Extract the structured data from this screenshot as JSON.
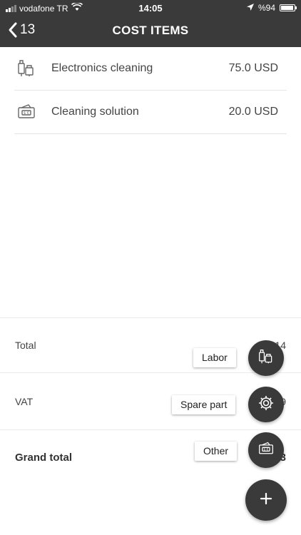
{
  "status_bar": {
    "carrier": "vodafone TR",
    "time": "14:05",
    "battery": "%94",
    "battery_level": 0.94
  },
  "header": {
    "back_label": "13",
    "title": "COST ITEMS",
    "background": "#3a3a3a"
  },
  "items": [
    {
      "icon": "electronics-cleaning-icon",
      "name": "Electronics cleaning",
      "amount": "75.0 USD"
    },
    {
      "icon": "money-wallet-icon",
      "name": "Cleaning solution",
      "amount": "20.0 USD"
    }
  ],
  "totals": {
    "total_label": "Total",
    "total_value": "…14",
    "vat_label": "VAT",
    "vat_value": "…9",
    "grand_total_label": "Grand total",
    "grand_total_value": "…3"
  },
  "fab_menu": {
    "labor_label": "Labor",
    "spare_part_label": "Spare part",
    "other_label": "Other",
    "main_icon": "plus-icon"
  }
}
